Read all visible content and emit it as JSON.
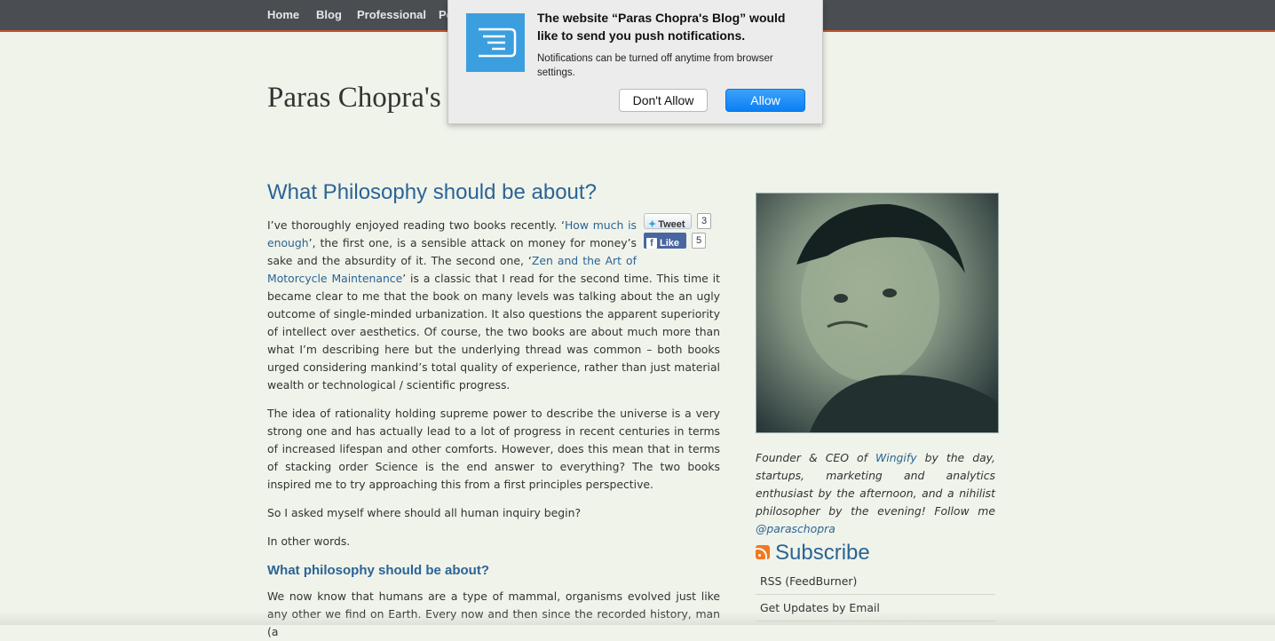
{
  "nav": {
    "items": [
      "Home",
      "Blog",
      "Professional",
      "Pe"
    ]
  },
  "site": {
    "title": "Paras Chopra's"
  },
  "post": {
    "title": "What Philosophy should be about?",
    "p1": {
      "t1": "I’ve thoroughly enjoyed reading two books recently. ‘",
      "link1": "How much is enough",
      "t2": "’, the first one, is a sensible attack on money for money’s sake and the absurdity of it. The second one, ‘",
      "link2": "Zen and the Art of Motorcycle Maintenance",
      "t3": "’ is a classic that I read for the second time. This time it became clear to me that the book on many levels was talking about the an ugly outcome of single-minded urbanization. It also questions the apparent superiority of intellect over aesthetics. Of course, the two books are about much more than what I’m describing here but the underlying thread was common – both books urged considering mankind’s total quality of experience, rather than just material wealth or technological / scientific progress."
    },
    "p2": "The idea of rationality holding supreme power to describe the universe is a very strong one and has actually lead to a lot of progress in recent centuries in terms of increased lifespan and other comforts. However, does this mean that in terms of stacking order Science is the end answer to everything? The two books inspired me to try approaching this from a first principles perspective.",
    "p3": "So I asked myself where should all human inquiry begin?",
    "p4": "In other words.",
    "subheading": "What philosophy should be about?",
    "p5": "We now know that humans are a type of mammal, organisms evolved just like any other we find on Earth. Every now and then since the recorded history, man (a"
  },
  "share": {
    "tweet_label": "Tweet",
    "tweet_count": "3",
    "like_label": "Like",
    "like_count": "5"
  },
  "sidebar": {
    "bio": {
      "t1": "Founder & CEO of ",
      "link1": "Wingify",
      "t2": " by the day, startups, marketing and analytics enthusiast by the afternoon, and a nihilist philosopher by the evening! Follow me ",
      "link2": "@paraschopra"
    },
    "subscribe_title": "Subscribe",
    "links": [
      "RSS (FeedBurner)",
      "Get Updates by Email"
    ]
  },
  "notification": {
    "title": "The website “Paras Chopra's Blog” would like to send you push notifications.",
    "body": "Notifications can be turned off anytime from browser settings.",
    "deny_label": "Don't Allow",
    "allow_label": "Allow"
  },
  "colors": {
    "background": "#f0f3ea",
    "nav": "#4a4e52",
    "link": "#2a6496",
    "allow_button": "#1a86f5",
    "notif_icon": "#3b9ede"
  }
}
